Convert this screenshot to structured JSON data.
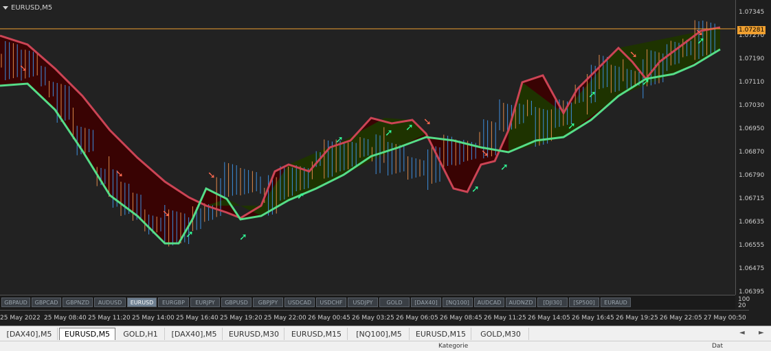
{
  "chart": {
    "title": "EURUSD,M5",
    "current_price": "1.07281",
    "colors": {
      "bear_fill": "#3c0000",
      "bull_fill": "#1e3300",
      "bear_line": "#cc4455",
      "bull_line": "#55dd88",
      "bear_arrow": "#ff6a50",
      "bull_arrow": "#33ff99",
      "candle_up": "#3d8fe0",
      "candle_down": "#e08a4a",
      "price_line": "#f0a030"
    }
  },
  "price_axis": [
    "1.07345",
    "1.07270",
    "1.07190",
    "1.07110",
    "1.07030",
    "1.06950",
    "1.06870",
    "1.06790",
    "1.06715",
    "1.06635",
    "1.06555",
    "1.06475",
    "1.06395"
  ],
  "symbol_buttons": [
    "GBPAUD",
    "GBPCAD",
    "GBPNZD",
    "AUDUSD",
    "EURUSD",
    "EURGBP",
    "EURJPY",
    "GBPUSD",
    "GBPJPY",
    "USDCAD",
    "USDCHF",
    "USDJPY",
    "GOLD",
    "[DAX40]",
    "[NQ100]",
    "AUDCAD",
    "AUDNZD",
    "[DJI30]",
    "[SP500]",
    "EURAUD"
  ],
  "active_symbol": "EURUSD",
  "indicator_scale": {
    "top": "100",
    "bottom": "20"
  },
  "time_axis": [
    "25 May 2022",
    "25 May 08:40",
    "25 May 11:20",
    "25 May 14:00",
    "25 May 16:40",
    "25 May 19:20",
    "25 May 22:00",
    "26 May 00:45",
    "26 May 03:25",
    "26 May 06:05",
    "26 May 08:45",
    "26 May 11:25",
    "26 May 14:05",
    "26 May 16:45",
    "26 May 19:25",
    "26 May 22:05",
    "27 May 00:50"
  ],
  "tabs": [
    "[DAX40],M5",
    "EURUSD,M5",
    "GOLD,H1",
    "[DAX40],M5",
    "EURUSD,M30",
    "EURUSD,M15",
    "[NQ100],M5",
    "EURUSD,M15",
    "GOLD,M30"
  ],
  "active_tab": 1,
  "tab_nav": {
    "left": "◄",
    "right": "►"
  },
  "status": {
    "left": "Kategorie",
    "right": "Dat"
  }
}
